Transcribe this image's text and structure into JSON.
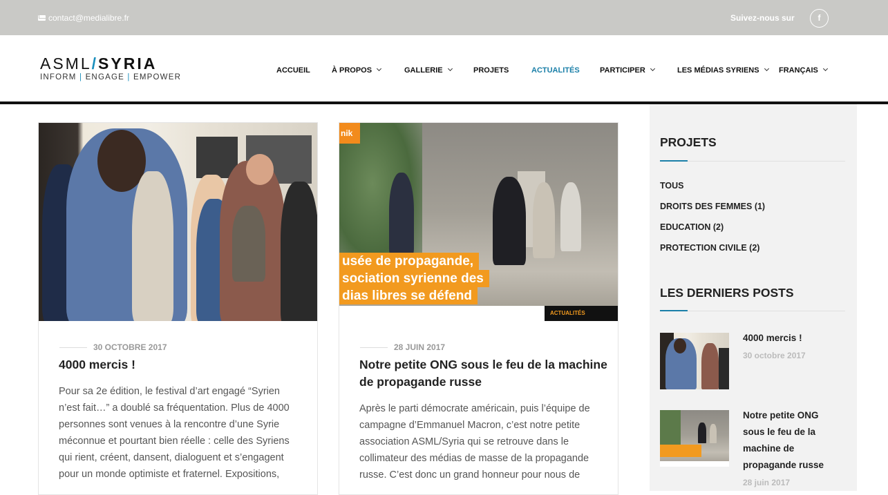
{
  "topbar": {
    "email": "contact@medialibre.fr",
    "follow_label": "Suivez-nous sur",
    "facebook_glyph": "f"
  },
  "logo": {
    "part1": "ASML",
    "slash": "/",
    "part2": "SYRIA",
    "tag1": "INFORM",
    "sep": "|",
    "tag2": "ENGAGE",
    "tag3": "EMPOWER"
  },
  "nav": [
    {
      "label": "ACCUEIL",
      "dropdown": false,
      "active": false
    },
    {
      "label": "À PROPOS",
      "dropdown": true,
      "active": false
    },
    {
      "label": "GALLERIE",
      "dropdown": true,
      "active": false
    },
    {
      "label": "PROJETS",
      "dropdown": false,
      "active": false
    },
    {
      "label": "ACTUALITÉS",
      "dropdown": false,
      "active": true
    },
    {
      "label": "PARTICIPER",
      "dropdown": true,
      "active": false
    },
    {
      "label": "LES MÉDIAS SYRIENS",
      "dropdown": true,
      "active": false
    },
    {
      "label": "FRANÇAIS",
      "dropdown": true,
      "active": false
    }
  ],
  "posts": [
    {
      "date": "30 OCTOBRE 2017",
      "title": "4000 mercis !",
      "excerpt": "Pour sa 2e édition, le festival d’art engagé “Syrien n’est fait…” a doublé sa fréquentation. Plus de 4000 personnes sont venues à la rencontre d’une Syrie méconnue et pourtant bien réelle : celle des Syriens qui rient, créent, dansent, dialoguent et s’engagent pour un monde optimiste et fraternel. Expositions,"
    },
    {
      "date": "28 JUIN 2017",
      "title": "Notre petite ONG sous le feu de la machine de propagande russe",
      "excerpt": "Après le parti démocrate américain, puis l’équipe de campagne d’Emmanuel Macron, c’est notre petite association ASML/Syria qui se retrouve dans le collimateur des médias de masse de la propagande russe. C’est donc un grand honneur pour nous de",
      "image_text": {
        "brand": "nik",
        "line1": "usée de propagande,",
        "line2": "sociation syrienne des",
        "line3": "dias libres se défend",
        "footer_tag": "ACTUALITÉS"
      }
    }
  ],
  "sidebar": {
    "projets_title": "PROJETS",
    "categories": [
      "TOUS",
      "DROITS DES FEMMES (1)",
      "EDUCATION (2)",
      "PROTECTION CIVILE (2)"
    ],
    "recent_title": "LES DERNIERS POSTS",
    "recent_posts": [
      {
        "title": "4000 mercis !",
        "date": "30 octobre 2017"
      },
      {
        "title": "Notre petite ONG sous le feu de la machine de propagande russe",
        "date": "28 juin 2017"
      }
    ]
  },
  "colors": {
    "accent": "#1a7fa8",
    "topbar": "#c9c9c6",
    "orange": "#f29a1f"
  }
}
